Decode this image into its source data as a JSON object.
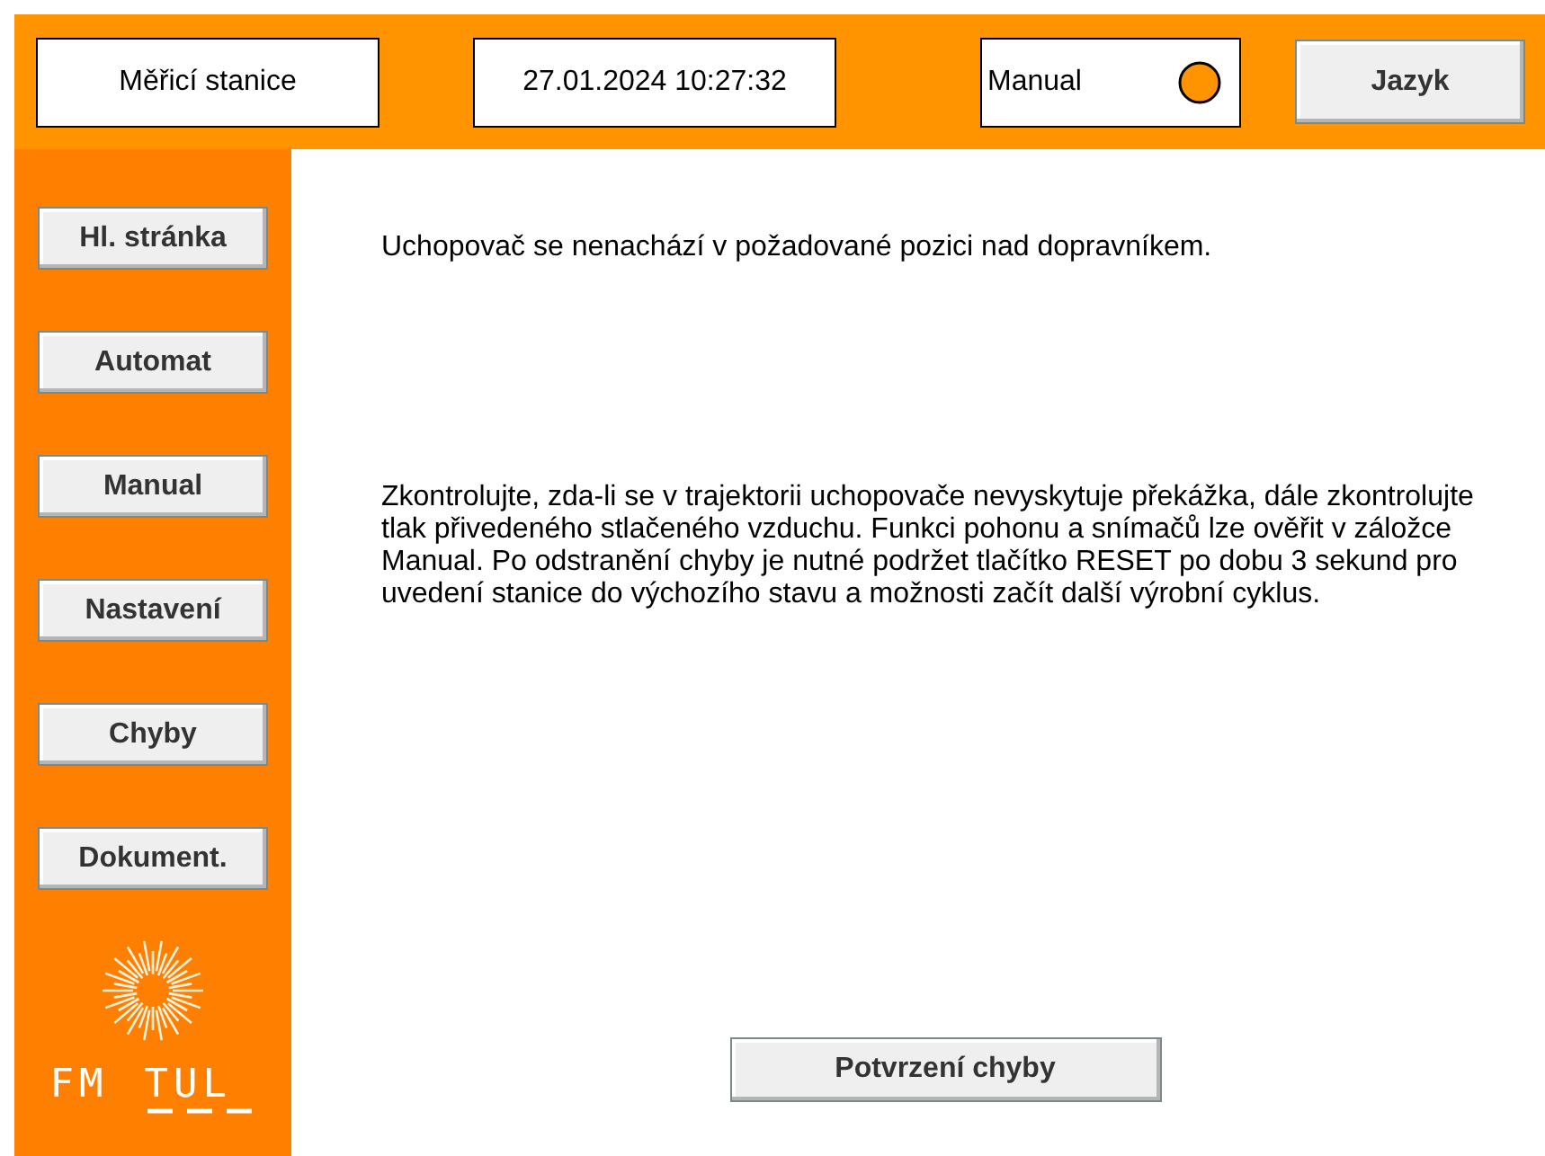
{
  "header": {
    "station": "Měřicí stanice",
    "datetime": "27.01.2024 10:27:32",
    "mode": "Manual",
    "language_button": "Jazyk"
  },
  "sidebar": {
    "items": [
      "Hl. stránka",
      "Automat",
      "Manual",
      "Nastavení",
      "Chyby",
      "Dokument."
    ],
    "logo_text": [
      "FM",
      "TUL"
    ]
  },
  "error": {
    "message": "Uchopovač se nenachází v požadované pozici nad dopravníkem.",
    "instructions": "Zkontrolujte, zda-li se v trajektorii uchopovače nevyskytuje překážka, dále zkontrolujte tlak přivedeného stlačeného vzduchu. Funkci pohonu a snímačů lze ověřit v záložce Manual. Po odstranění chyby je nutné podržet tlačítko RESET po dobu 3 sekund pro uvedení stanice do výchozího stavu a možnosti začít další výrobní cyklus.",
    "confirm_button": "Potvrzení chyby"
  }
}
